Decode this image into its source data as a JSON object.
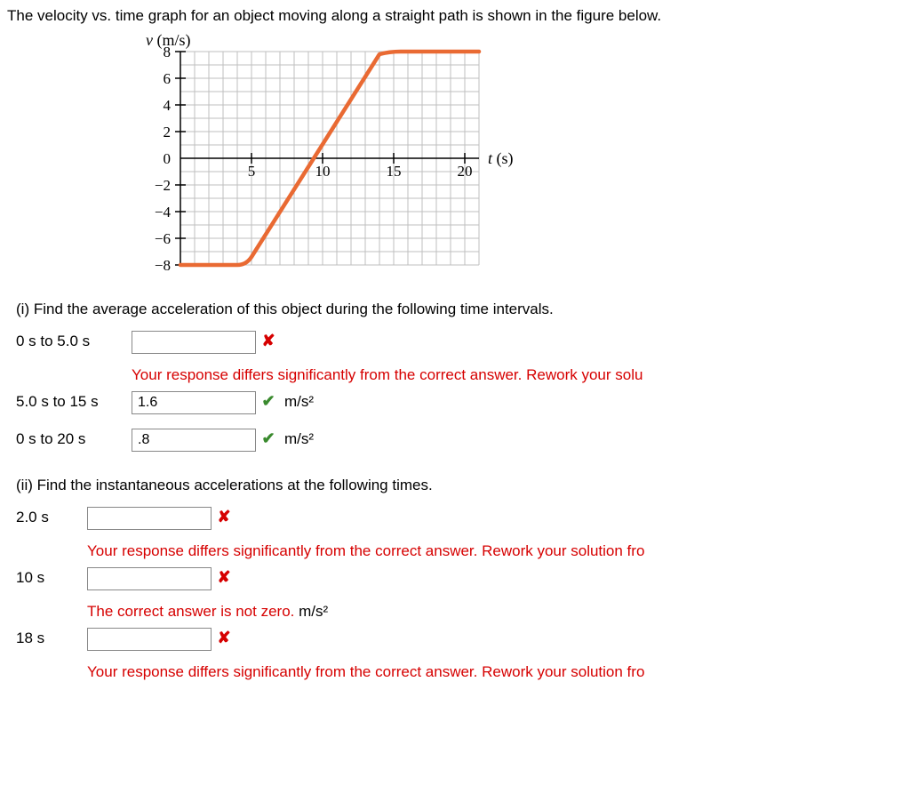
{
  "question_intro": "The velocity vs. time graph for an object moving along a straight path is shown in the figure below.",
  "chart_data": {
    "type": "line",
    "xlabel": "t (s)",
    "ylabel": "v (m/s)",
    "xlim": [
      0,
      21
    ],
    "ylim": [
      -8,
      8
    ],
    "xticks": [
      5,
      10,
      15,
      20
    ],
    "yticks": [
      -8,
      -6,
      -4,
      -2,
      0,
      2,
      4,
      6,
      8
    ],
    "series": [
      {
        "name": "velocity",
        "points": [
          [
            0,
            -8
          ],
          [
            4,
            -8
          ],
          [
            5,
            -7.4
          ],
          [
            6,
            -5.8
          ],
          [
            7,
            -4.2
          ],
          [
            8,
            -2.6
          ],
          [
            9,
            -1
          ],
          [
            10,
            0.6
          ],
          [
            11,
            2.2
          ],
          [
            12,
            3.8
          ],
          [
            13,
            5.4
          ],
          [
            14,
            7
          ],
          [
            15,
            7.8
          ],
          [
            15.5,
            8
          ],
          [
            21,
            8
          ]
        ]
      }
    ]
  },
  "part1": {
    "prompt": "(i) Find the average acceleration of this object during the following time intervals.",
    "rows": [
      {
        "label": "0 s to 5.0 s",
        "value": "",
        "mark": "wrong",
        "unit": "",
        "feedback": "Your response differs significantly from the correct answer. Rework your solu"
      },
      {
        "label": "5.0 s to 15 s",
        "value": "1.6",
        "mark": "right",
        "unit": "m/s²",
        "feedback": ""
      },
      {
        "label": "0 s to 20 s",
        "value": ".8",
        "mark": "right",
        "unit": "m/s²",
        "feedback": ""
      }
    ]
  },
  "part2": {
    "prompt": "(ii) Find the instantaneous accelerations at the following times.",
    "rows": [
      {
        "label": "2.0 s",
        "value": "",
        "mark": "wrong",
        "unit": "",
        "feedback": "Your response differs significantly from the correct answer. Rework your solution fro"
      },
      {
        "label": "10 s",
        "value": "",
        "mark": "wrong",
        "unit": "",
        "feedback": "The correct answer is not zero. ",
        "feedback_suffix_black": "m/s²"
      },
      {
        "label": "18 s",
        "value": "",
        "mark": "wrong",
        "unit": "",
        "feedback": "Your response differs significantly from the correct answer. Rework your solution fro"
      }
    ]
  },
  "marks": {
    "wrong": "✘",
    "right": "✔"
  }
}
